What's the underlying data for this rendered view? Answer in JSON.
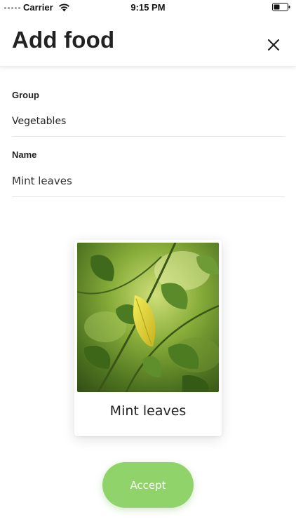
{
  "status_bar": {
    "carrier": "Carrier",
    "time": "9:15 PM"
  },
  "header": {
    "title": "Add food",
    "close_icon": "close-icon"
  },
  "form": {
    "group": {
      "label": "Group",
      "value": "Vegetables"
    },
    "name": {
      "label": "Name",
      "value": "Mint leaves"
    }
  },
  "card": {
    "image_icon": "leaf-photo",
    "name": "Mint leaves"
  },
  "actions": {
    "accept_label": "Accept"
  },
  "colors": {
    "accent": "#8fd36a",
    "text": "#222222",
    "divider": "#e8e8e8"
  }
}
